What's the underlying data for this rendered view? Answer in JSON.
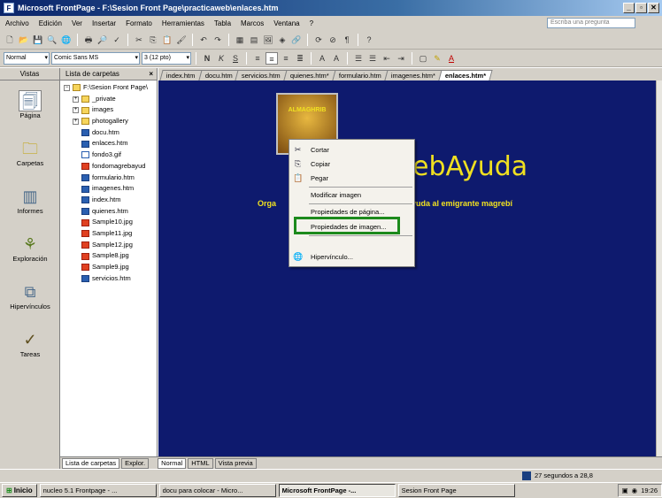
{
  "window": {
    "title": "Microsoft FrontPage - F:\\Sesion Front Page\\practicaweb\\enlaces.htm",
    "minimize": "_",
    "maximize": "▫",
    "close": "✕"
  },
  "menubar": {
    "items": [
      "Archivo",
      "Edición",
      "Ver",
      "Insertar",
      "Formato",
      "Herramientas",
      "Tabla",
      "Marcos",
      "Ventana",
      "?"
    ],
    "ask_placeholder": "Escriba una pregunta"
  },
  "formatting": {
    "style": "Normal",
    "font": "Comic Sans MS",
    "size": "3 (12 pto)",
    "bold": "N",
    "italic": "K",
    "underline": "S"
  },
  "views": {
    "header": "Vistas",
    "items": [
      {
        "label": "Página",
        "icon": "page-icon"
      },
      {
        "label": "Carpetas",
        "icon": "folder-icon"
      },
      {
        "label": "Informes",
        "icon": "reports-icon"
      },
      {
        "label": "Exploración",
        "icon": "navigation-icon"
      },
      {
        "label": "Hipervínculos",
        "icon": "hyperlinks-icon"
      },
      {
        "label": "Tareas",
        "icon": "tasks-icon"
      }
    ]
  },
  "folder_list": {
    "header": "Lista de carpetas",
    "close": "×",
    "root": "F:\\Sesion Front Page\\",
    "items": [
      {
        "name": "_private",
        "type": "folder"
      },
      {
        "name": "images",
        "type": "folder"
      },
      {
        "name": "photogallery",
        "type": "folder"
      },
      {
        "name": "docu.htm",
        "type": "htm"
      },
      {
        "name": "enlaces.htm",
        "type": "htm"
      },
      {
        "name": "fondo3.gif",
        "type": "gif"
      },
      {
        "name": "fondomagrebayud",
        "type": "img"
      },
      {
        "name": "formulario.htm",
        "type": "htm"
      },
      {
        "name": "imagenes.htm",
        "type": "htm"
      },
      {
        "name": "index.htm",
        "type": "htm"
      },
      {
        "name": "quienes.htm",
        "type": "htm"
      },
      {
        "name": "Sample10.jpg",
        "type": "img"
      },
      {
        "name": "Sample11.jpg",
        "type": "img"
      },
      {
        "name": "Sample12.jpg",
        "type": "img"
      },
      {
        "name": "Sample8.jpg",
        "type": "img"
      },
      {
        "name": "Sample9.jpg",
        "type": "img"
      },
      {
        "name": "servicios.htm",
        "type": "htm"
      }
    ]
  },
  "tabs": [
    "index.htm",
    "docu.htm",
    "servicios.htm",
    "quienes.htm*",
    "formulario.htm",
    "imagenes.htm*",
    "enlaces.htm*"
  ],
  "active_tab": "enlaces.htm*",
  "page": {
    "logo_text": "ALMAGHRIB",
    "heading_visible": "ebAyuda",
    "subtitle_left": "Orga",
    "subtitle_right": "de ayuda al emigrante magrebí",
    "background": "#0e1a6e",
    "text_color": "#f0e020"
  },
  "context_menu": {
    "items": [
      {
        "label": "Cortar",
        "icon": "scissors-icon"
      },
      {
        "label": "Copiar",
        "icon": "copy-icon"
      },
      {
        "label": "Pegar",
        "icon": "paste-icon"
      },
      {
        "label": "Modificar imagen",
        "icon": ""
      },
      {
        "label": "Propiedades de página...",
        "icon": ""
      },
      {
        "label": "Propiedades de imagen...",
        "icon": ""
      },
      {
        "label": "Hipervínculo...",
        "icon": "globe-link-icon"
      }
    ],
    "highlight_color": "#1c8a1c"
  },
  "bottom_tabs": {
    "folder_list": "Lista de carpetas",
    "explorer": "Explor.",
    "normal": "Normal",
    "html": "HTML",
    "preview": "Vista previa"
  },
  "status": {
    "text": "27 segundos a 28,8"
  },
  "taskbar": {
    "start": "Inicio",
    "buttons": [
      {
        "label": "nucleo 5.1 Frontpage - ...",
        "active": false
      },
      {
        "label": "docu para colocar - Micro...",
        "active": false
      },
      {
        "label": "Microsoft FrontPage -...",
        "active": true
      },
      {
        "label": "Sesion Front Page",
        "active": false
      }
    ],
    "clock": "19:26"
  }
}
